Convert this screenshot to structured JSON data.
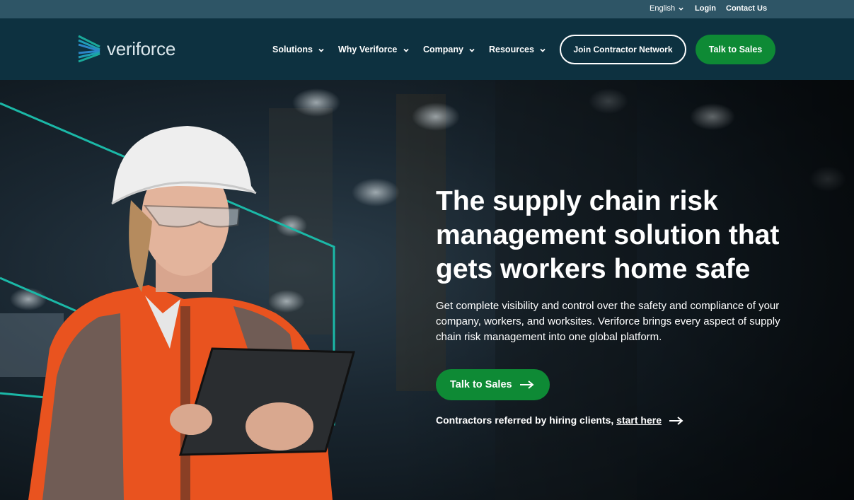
{
  "utility_bar": {
    "language": "English",
    "login": "Login",
    "contact": "Contact Us"
  },
  "nav": {
    "logo_text": "veriforce",
    "items": [
      {
        "label": "Solutions"
      },
      {
        "label": "Why Veriforce"
      },
      {
        "label": "Company"
      },
      {
        "label": "Resources"
      }
    ],
    "join_button": "Join Contractor Network",
    "sales_button": "Talk to Sales"
  },
  "hero": {
    "title": "The supply chain risk management solution that gets workers home safe",
    "body": "Get complete visibility and control over the safety and compliance of your company, workers, and worksites. Veriforce brings every aspect of supply chain risk management into one global platform.",
    "cta_label": "Talk to Sales",
    "referral_text": "Contractors referred by hiring clients,",
    "referral_link": "start here"
  },
  "colors": {
    "utility_bg": "#2e5566",
    "nav_bg": "#0d3140",
    "accent_green": "#0e8a35",
    "accent_teal": "#1bb8a7"
  },
  "icons": [
    "chevron-down-icon",
    "arrow-right-icon",
    "veriforce-logo-mark"
  ]
}
